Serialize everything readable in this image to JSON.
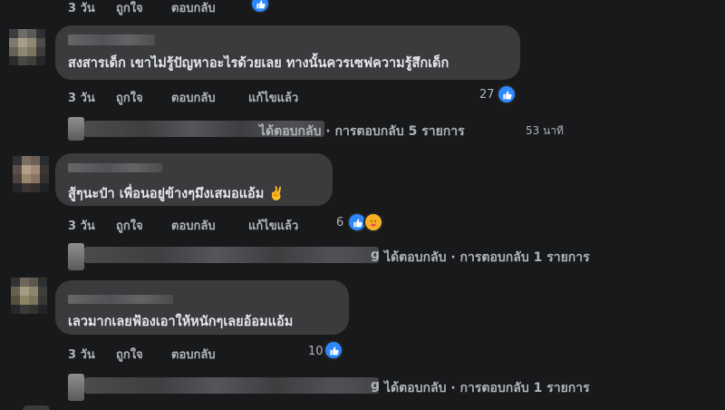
{
  "top_actions": {
    "time": "3 วัน",
    "like": "ถูกใจ",
    "reply": "ตอบกลับ"
  },
  "comments": [
    {
      "text": "สงสารเด็ก เขาไม่รู้ปัญหาอะไรด้วยเลย ทางนั้นควรเซฟความรู้สึกเด็ก",
      "time": "3 วัน",
      "like": "ถูกใจ",
      "reply": "ตอบกลับ",
      "edited": "แก้ไขแล้ว",
      "reaction_count": "27",
      "replies": {
        "text": "ได้ตอบกลับ · การตอบกลับ 5 รายการ",
        "time": "53 นาที"
      }
    },
    {
      "text": "สู้ๆนะป๋า เพื่อนอยู่ข้างๆมึงเสมอแอ้ม ✌️",
      "time": "3 วัน",
      "like": "ถูกใจ",
      "reply": "ตอบกลับ",
      "edited": "แก้ไขแล้ว",
      "reaction_count": "6",
      "replies": {
        "text": "ได้ตอบกลับ · การตอบกลับ 1 รายการ",
        "name_tail": "g"
      }
    },
    {
      "text": "เลวมากเลยฟ้องเอาให้หนักๆเลยอ้อมแอ้ม",
      "time": "3 วัน",
      "like": "ถูกใจ",
      "reply": "ตอบกลับ",
      "reaction_count": "10",
      "replies": {
        "text": "ได้ตอบกลับ · การตอบกลับ 1 รายการ",
        "name_tail": "g"
      }
    }
  ],
  "colors": {
    "background": "#18191a",
    "bubble": "#3a3b3c",
    "like_blue": "#2d88ff",
    "care_yellow": "#f7b125"
  },
  "icons": [
    "like-reaction-icon",
    "care-reaction-icon"
  ]
}
